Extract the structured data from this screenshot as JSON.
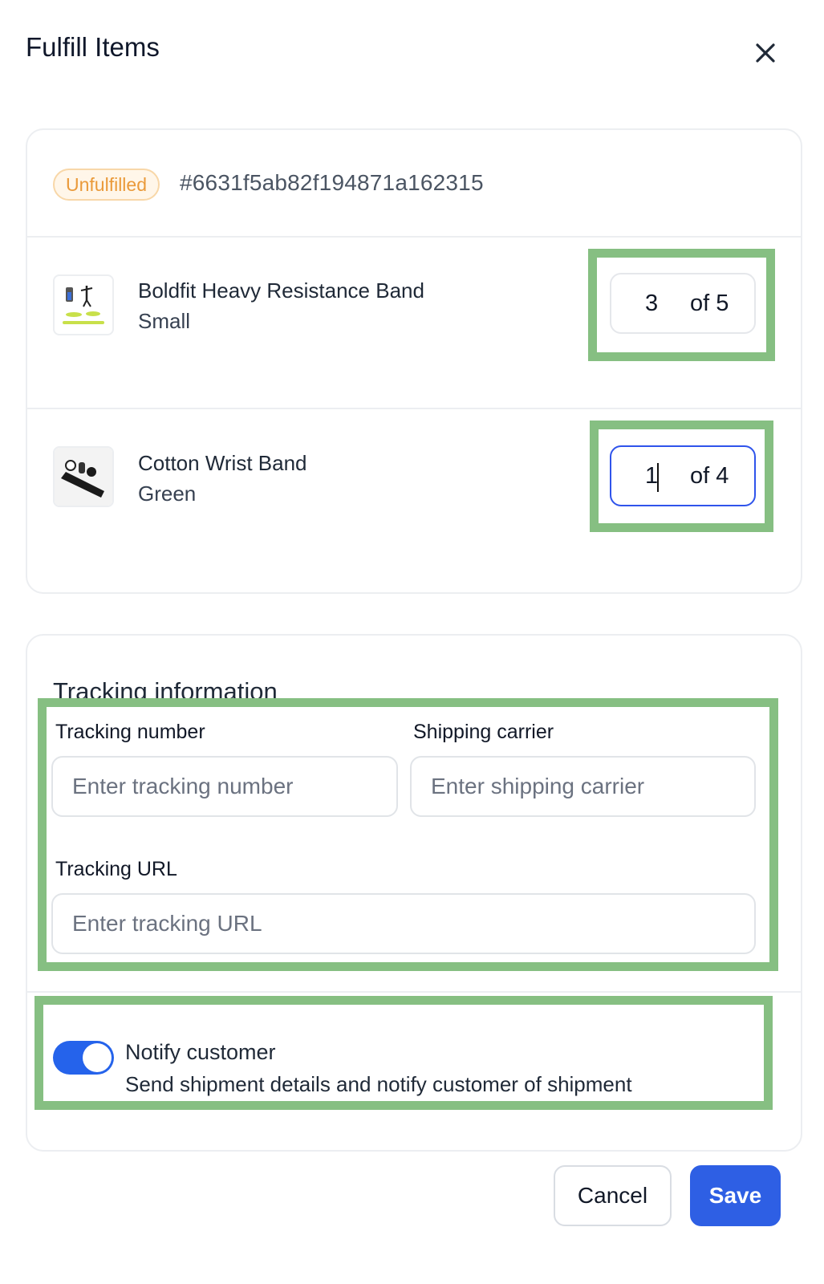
{
  "dialog": {
    "title": "Fulfill Items",
    "close_icon": "close-icon"
  },
  "order": {
    "status_badge": "Unfulfilled",
    "id": "#6631f5ab82f194871a162315",
    "status_color": "#ea9a3a"
  },
  "items": [
    {
      "name": "Boldfit Heavy Resistance Band",
      "variant": "Small",
      "quantity": "3",
      "of_label": "of 5",
      "thumbnail_icon": "resistance-band-image"
    },
    {
      "name": "Cotton Wrist Band",
      "variant": "Green",
      "quantity": "1",
      "of_label": "of 4",
      "thumbnail_icon": "wrist-band-image"
    }
  ],
  "tracking": {
    "section_title": "Tracking information",
    "tracking_number_label": "Tracking number",
    "tracking_number_placeholder": "Enter tracking number",
    "tracking_number_value": "",
    "shipping_carrier_label": "Shipping carrier",
    "shipping_carrier_placeholder": "Enter shipping carrier",
    "shipping_carrier_value": "",
    "tracking_url_label": "Tracking URL",
    "tracking_url_placeholder": "Enter tracking URL",
    "tracking_url_value": ""
  },
  "notify": {
    "enabled": true,
    "title": "Notify customer",
    "description": "Send shipment details and notify customer of shipment"
  },
  "footer": {
    "cancel_label": "Cancel",
    "save_label": "Save"
  },
  "colors": {
    "primary": "#2e5fe4",
    "highlight": "#86bf82",
    "badge_bg": "#fff6e9"
  }
}
